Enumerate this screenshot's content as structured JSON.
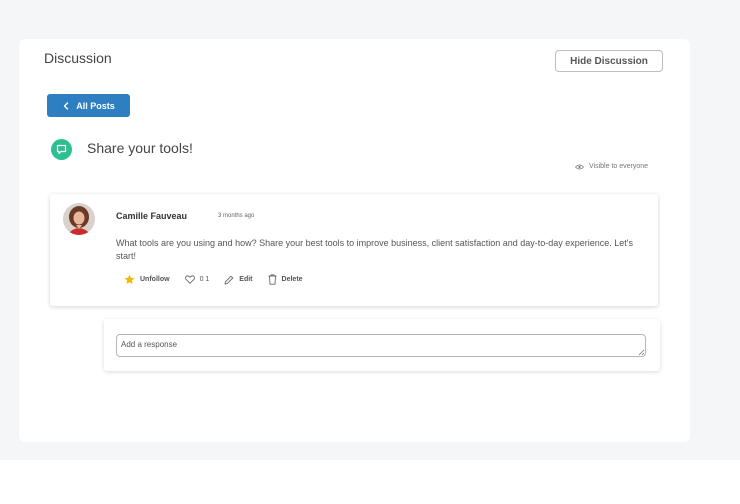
{
  "panel": {
    "title": "Discussion",
    "hide_button": "Hide Discussion",
    "back_button": "All Posts"
  },
  "topic": {
    "title": "Share your tools!",
    "visibility": "Visible to everyone",
    "icon": "chat-bubble-icon",
    "icon_color": "#2dbf90"
  },
  "post": {
    "author": "Camille Fauveau",
    "time": "3 months ago",
    "body": "What tools are you using and how? Share your best tools to improve business, client satisfaction and day-to-day experience. Let's start!",
    "actions": {
      "unfollow": "Unfollow",
      "likes": "0 1",
      "edit": "Edit",
      "delete": "Delete"
    }
  },
  "reply": {
    "placeholder": "Add a response"
  },
  "colors": {
    "accent": "#2d7fc1",
    "star": "#f5b800"
  }
}
